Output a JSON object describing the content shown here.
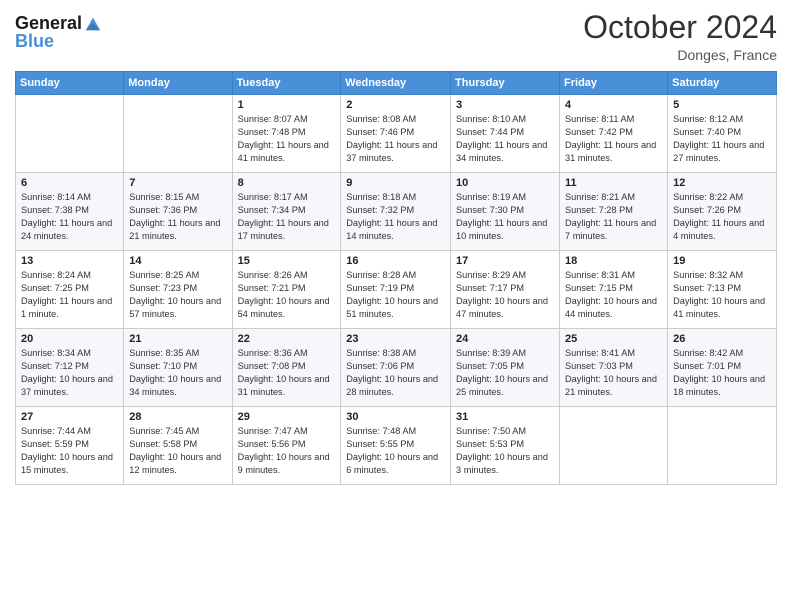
{
  "logo": {
    "line1": "General",
    "line2": "Blue"
  },
  "header": {
    "month": "October 2024",
    "location": "Donges, France"
  },
  "weekdays": [
    "Sunday",
    "Monday",
    "Tuesday",
    "Wednesday",
    "Thursday",
    "Friday",
    "Saturday"
  ],
  "weeks": [
    [
      {
        "day": "",
        "info": ""
      },
      {
        "day": "",
        "info": ""
      },
      {
        "day": "1",
        "info": "Sunrise: 8:07 AM\nSunset: 7:48 PM\nDaylight: 11 hours and 41 minutes."
      },
      {
        "day": "2",
        "info": "Sunrise: 8:08 AM\nSunset: 7:46 PM\nDaylight: 11 hours and 37 minutes."
      },
      {
        "day": "3",
        "info": "Sunrise: 8:10 AM\nSunset: 7:44 PM\nDaylight: 11 hours and 34 minutes."
      },
      {
        "day": "4",
        "info": "Sunrise: 8:11 AM\nSunset: 7:42 PM\nDaylight: 11 hours and 31 minutes."
      },
      {
        "day": "5",
        "info": "Sunrise: 8:12 AM\nSunset: 7:40 PM\nDaylight: 11 hours and 27 minutes."
      }
    ],
    [
      {
        "day": "6",
        "info": "Sunrise: 8:14 AM\nSunset: 7:38 PM\nDaylight: 11 hours and 24 minutes."
      },
      {
        "day": "7",
        "info": "Sunrise: 8:15 AM\nSunset: 7:36 PM\nDaylight: 11 hours and 21 minutes."
      },
      {
        "day": "8",
        "info": "Sunrise: 8:17 AM\nSunset: 7:34 PM\nDaylight: 11 hours and 17 minutes."
      },
      {
        "day": "9",
        "info": "Sunrise: 8:18 AM\nSunset: 7:32 PM\nDaylight: 11 hours and 14 minutes."
      },
      {
        "day": "10",
        "info": "Sunrise: 8:19 AM\nSunset: 7:30 PM\nDaylight: 11 hours and 10 minutes."
      },
      {
        "day": "11",
        "info": "Sunrise: 8:21 AM\nSunset: 7:28 PM\nDaylight: 11 hours and 7 minutes."
      },
      {
        "day": "12",
        "info": "Sunrise: 8:22 AM\nSunset: 7:26 PM\nDaylight: 11 hours and 4 minutes."
      }
    ],
    [
      {
        "day": "13",
        "info": "Sunrise: 8:24 AM\nSunset: 7:25 PM\nDaylight: 11 hours and 1 minute."
      },
      {
        "day": "14",
        "info": "Sunrise: 8:25 AM\nSunset: 7:23 PM\nDaylight: 10 hours and 57 minutes."
      },
      {
        "day": "15",
        "info": "Sunrise: 8:26 AM\nSunset: 7:21 PM\nDaylight: 10 hours and 54 minutes."
      },
      {
        "day": "16",
        "info": "Sunrise: 8:28 AM\nSunset: 7:19 PM\nDaylight: 10 hours and 51 minutes."
      },
      {
        "day": "17",
        "info": "Sunrise: 8:29 AM\nSunset: 7:17 PM\nDaylight: 10 hours and 47 minutes."
      },
      {
        "day": "18",
        "info": "Sunrise: 8:31 AM\nSunset: 7:15 PM\nDaylight: 10 hours and 44 minutes."
      },
      {
        "day": "19",
        "info": "Sunrise: 8:32 AM\nSunset: 7:13 PM\nDaylight: 10 hours and 41 minutes."
      }
    ],
    [
      {
        "day": "20",
        "info": "Sunrise: 8:34 AM\nSunset: 7:12 PM\nDaylight: 10 hours and 37 minutes."
      },
      {
        "day": "21",
        "info": "Sunrise: 8:35 AM\nSunset: 7:10 PM\nDaylight: 10 hours and 34 minutes."
      },
      {
        "day": "22",
        "info": "Sunrise: 8:36 AM\nSunset: 7:08 PM\nDaylight: 10 hours and 31 minutes."
      },
      {
        "day": "23",
        "info": "Sunrise: 8:38 AM\nSunset: 7:06 PM\nDaylight: 10 hours and 28 minutes."
      },
      {
        "day": "24",
        "info": "Sunrise: 8:39 AM\nSunset: 7:05 PM\nDaylight: 10 hours and 25 minutes."
      },
      {
        "day": "25",
        "info": "Sunrise: 8:41 AM\nSunset: 7:03 PM\nDaylight: 10 hours and 21 minutes."
      },
      {
        "day": "26",
        "info": "Sunrise: 8:42 AM\nSunset: 7:01 PM\nDaylight: 10 hours and 18 minutes."
      }
    ],
    [
      {
        "day": "27",
        "info": "Sunrise: 7:44 AM\nSunset: 5:59 PM\nDaylight: 10 hours and 15 minutes."
      },
      {
        "day": "28",
        "info": "Sunrise: 7:45 AM\nSunset: 5:58 PM\nDaylight: 10 hours and 12 minutes."
      },
      {
        "day": "29",
        "info": "Sunrise: 7:47 AM\nSunset: 5:56 PM\nDaylight: 10 hours and 9 minutes."
      },
      {
        "day": "30",
        "info": "Sunrise: 7:48 AM\nSunset: 5:55 PM\nDaylight: 10 hours and 6 minutes."
      },
      {
        "day": "31",
        "info": "Sunrise: 7:50 AM\nSunset: 5:53 PM\nDaylight: 10 hours and 3 minutes."
      },
      {
        "day": "",
        "info": ""
      },
      {
        "day": "",
        "info": ""
      }
    ]
  ]
}
